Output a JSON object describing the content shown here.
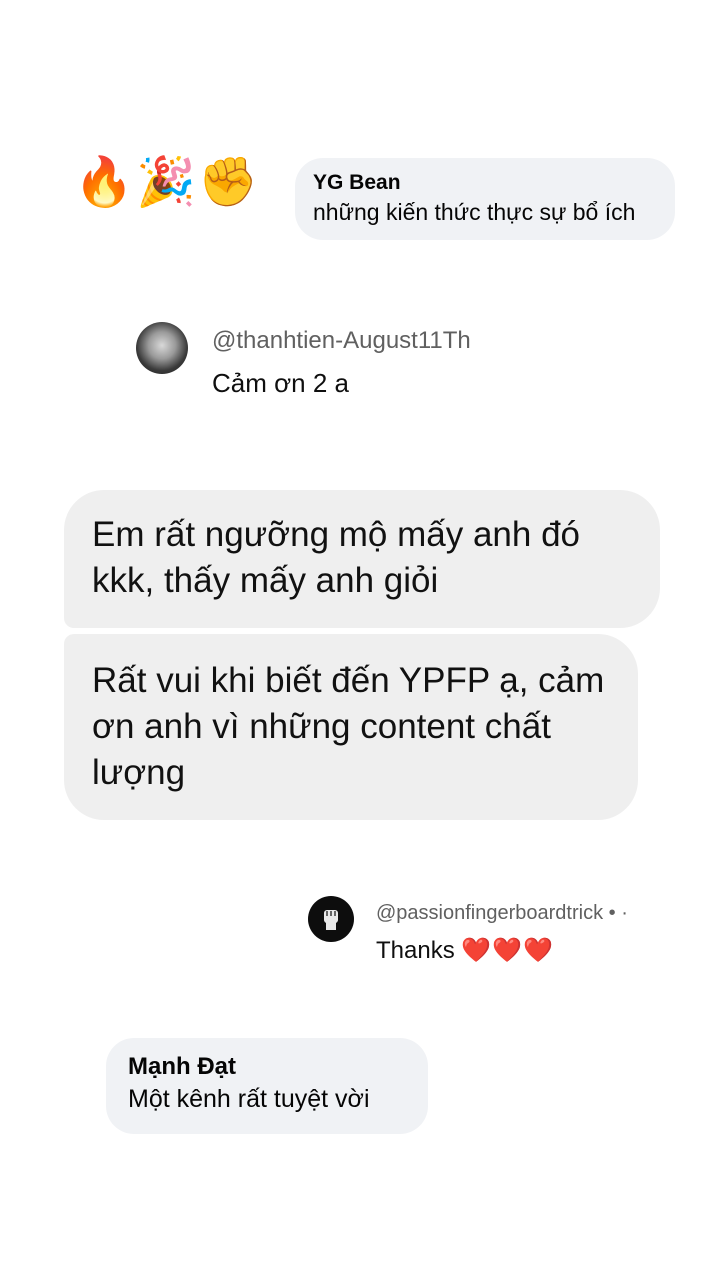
{
  "reactions": [
    {
      "icon": "fire-icon",
      "glyph": "🔥"
    },
    {
      "icon": "party-popper-icon",
      "glyph": "🎉"
    },
    {
      "icon": "raised-fist-icon",
      "glyph": "✊"
    }
  ],
  "comment_yg": {
    "name": "YG Bean",
    "text": "những kiến thức thực sự bổ ích"
  },
  "reply_thanhtien": {
    "handle": "@thanhtien-August11Th",
    "text": "Cảm ơn 2 a"
  },
  "messages": [
    {
      "text": "Em rất ngưỡng mộ mấy anh đó kkk, thấy mấy anh giỏi"
    },
    {
      "text": "Rất vui khi biết đến YPFP ạ, cảm ơn anh vì những content chất lượng"
    }
  ],
  "reply_passion": {
    "handle": "@passionfingerboardtrick • ·",
    "text": "Thanks",
    "hearts": "❤️❤️❤️"
  },
  "comment_manh": {
    "name": "Mạnh Đạt",
    "text": "Một kênh rất tuyệt vời"
  },
  "colors": {
    "bubble_fb": "#f0f2f5",
    "bubble_msg": "#efefef",
    "handle_gray": "#606060",
    "heart_red": "#e0242f"
  }
}
